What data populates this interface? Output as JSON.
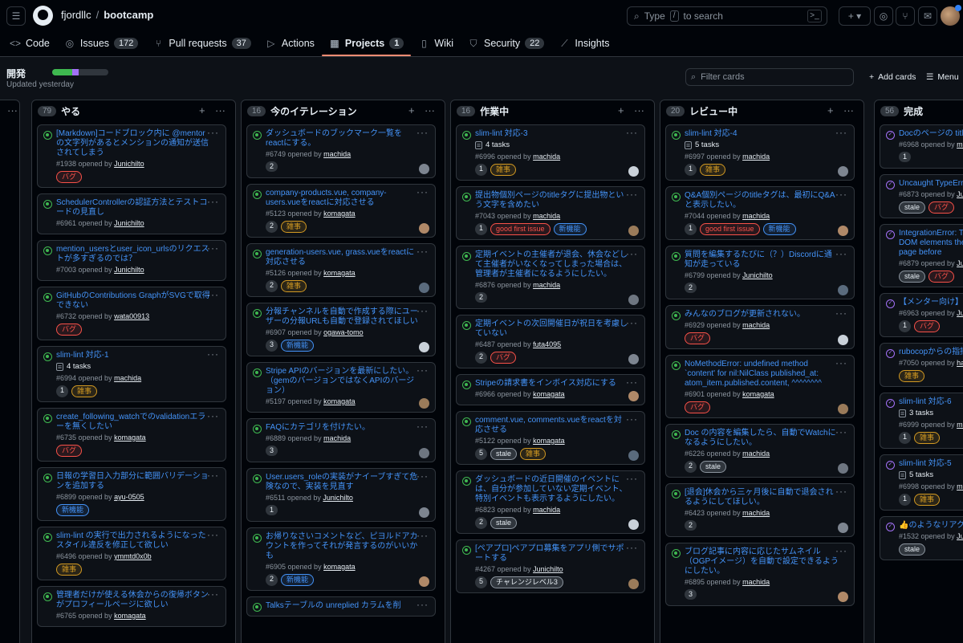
{
  "header": {
    "owner": "fjordllc",
    "separator": "/",
    "repo": "bootcamp",
    "search_label": "Type",
    "search_key": "/",
    "search_suffix": "to search"
  },
  "nav": [
    {
      "label": "Code",
      "icon": "<>",
      "count": ""
    },
    {
      "label": "Issues",
      "icon": "◎",
      "count": "172"
    },
    {
      "label": "Pull requests",
      "icon": "⑂",
      "count": "37"
    },
    {
      "label": "Actions",
      "icon": "▷",
      "count": ""
    },
    {
      "label": "Projects",
      "icon": "▦",
      "count": "1"
    },
    {
      "label": "Wiki",
      "icon": "▯",
      "count": ""
    },
    {
      "label": "Security",
      "icon": "⛉",
      "count": "22"
    },
    {
      "label": "Insights",
      "icon": "⟋",
      "count": ""
    }
  ],
  "project": {
    "title": "開発",
    "updated": "Updated yesterday",
    "progress": {
      "done": 0.35,
      "in_progress": 0.12
    },
    "filter_placeholder": "Filter cards",
    "add_cards": "Add cards",
    "menu": "Menu"
  },
  "colors": {
    "accent": "#4493f8",
    "open": "#3fb950",
    "done": "#a371f7",
    "bug": "#f85149",
    "chore": "#d29922",
    "feature": "#4493f8"
  },
  "columns": [
    {
      "count": "79",
      "title": "やる",
      "cards": [
        {
          "title": "[Markdown]コードブロック内に @mentor の文字列があるとメンションの通知が送信されてしまう",
          "meta_prefix": "#1938 opened by",
          "author": "Junichilto",
          "labels": [
            "バグ"
          ]
        },
        {
          "title": "SchedulerControllerの認証方法とテストコードの見直し",
          "meta_prefix": "#6961 opened by",
          "author": "Junichilto"
        },
        {
          "title": "mention_usersとuser_icon_urlsのリクエストが多すぎるのでは？",
          "meta_prefix": "#7003 opened by",
          "author": "Junichilto"
        },
        {
          "title": "GitHubのContributions GraphがSVGで取得できない",
          "meta_prefix": "#6732 opened by",
          "author": "wata00913",
          "labels": [
            "バグ"
          ]
        },
        {
          "title": "slim-lint 対応-1",
          "tasks": "4 tasks",
          "meta_prefix": "#6994 opened by",
          "author": "machida",
          "num": "1",
          "labels": [
            "雑事"
          ]
        },
        {
          "title": "create_following_watchでのvalidationエラーを無くしたい",
          "meta_prefix": "#6735 opened by",
          "author": "komagata",
          "labels": [
            "バグ"
          ]
        },
        {
          "title": "日報の学習日入力部分に範囲バリデーションを追加する",
          "meta_prefix": "#6899 opened by",
          "author": "ayu-0505",
          "labels": [
            "新機能"
          ]
        },
        {
          "title": "slim-lint の実行で出力されるようになったスタイル違反を修正して欲しい",
          "meta_prefix": "#6496 opened by",
          "author": "ymmtd0x0b",
          "labels": [
            "雑事"
          ]
        },
        {
          "title": "管理者だけが使える休会からの復帰ボタンがプロフィールページに欲しい",
          "meta_prefix": "#6765 opened by",
          "author": "komagata"
        }
      ]
    },
    {
      "count": "16",
      "title": "今のイテレーション",
      "cards": [
        {
          "title": "ダッシュボードのブックマーク一覧をreactにする。",
          "meta_prefix": "#6749 opened by",
          "author": "machida",
          "num": "2",
          "avatar": true
        },
        {
          "title": "company-products.vue, company-users.vueをreactに対応させる",
          "meta_prefix": "#5123 opened by",
          "author": "komagata",
          "num": "2",
          "labels": [
            "雑事"
          ],
          "avatar": true
        },
        {
          "title": "generation-users.vue, grass.vueをreactに対応させる",
          "meta_prefix": "#5126 opened by",
          "author": "komagata",
          "num": "2",
          "labels": [
            "雑事"
          ],
          "avatar": true
        },
        {
          "title": "分報チャンネルを自動で作成する際にユーザーの分報URLも自動で登録されてほしい",
          "meta_prefix": "#6907 opened by",
          "author": "ogawa-tomo",
          "num": "3",
          "labels": [
            "新機能"
          ],
          "avatar": true
        },
        {
          "title": "Stripe APIのバージョンを最新にしたい。（gemのバージョンではなくAPIのバージョン）",
          "meta_prefix": "#5197 opened by",
          "author": "komagata",
          "avatar": true
        },
        {
          "title": "FAQにカテゴリを付けたい。",
          "meta_prefix": "#6889 opened by",
          "author": "machida",
          "num": "3",
          "avatar": true
        },
        {
          "title": "User.users_roleの実装がナイーブすぎて危険なので、実装を見直す",
          "meta_prefix": "#6511 opened by",
          "author": "Junichilto",
          "num": "1",
          "avatar": true
        },
        {
          "title": "お帰りなさいコメントなど、ピヨルドアカウントを作ってそれが発言するのがいいかも",
          "meta_prefix": "#6905 opened by",
          "author": "komagata",
          "num": "2",
          "labels": [
            "新機能"
          ],
          "avatar": true
        },
        {
          "title": "Talksテーブルの unreplied カラムを削",
          "meta_prefix": "",
          "author": ""
        }
      ]
    },
    {
      "count": "16",
      "title": "作業中",
      "cards": [
        {
          "title": "slim-lint 対応-3",
          "tasks": "4 tasks",
          "meta_prefix": "#6996 opened by",
          "author": "machida",
          "num": "1",
          "labels": [
            "雑事"
          ],
          "avatar": true
        },
        {
          "title": "提出物個別ページのtitleタグに提出物という文字を含めたい",
          "meta_prefix": "#7043 opened by",
          "author": "machida",
          "num": "1",
          "labels": [
            "good first issue",
            "新機能"
          ],
          "avatar": true
        },
        {
          "title": "定期イベントの主催者が退会、休会などして主催者がいなくなってしまった場合は、管理者が主催者になるようにしたい。",
          "meta_prefix": "#6876 opened by",
          "author": "machida",
          "num": "2",
          "avatar": true
        },
        {
          "title": "定期イベントの次回開催日が祝日を考慮していない",
          "meta_prefix": "#6487 opened by",
          "author": "futa4095",
          "num": "2",
          "labels": [
            "バグ"
          ],
          "avatar": true
        },
        {
          "title": "Stripeの請求書をインボイス対応にする",
          "meta_prefix": "#6966 opened by",
          "author": "komagata",
          "avatar": true
        },
        {
          "title": "comment.vue, comments.vueをreactを対応させる",
          "meta_prefix": "#5122 opened by",
          "author": "komagata",
          "num": "5",
          "labels": [
            "stale",
            "雑事"
          ],
          "avatar": true
        },
        {
          "title": "ダッシュボードの近日開催のイベントには、自分が参加していない定期イベント、特別イベントも表示するようにしたい。",
          "meta_prefix": "#6823 opened by",
          "author": "machida",
          "num": "2",
          "labels": [
            "stale"
          ],
          "avatar": true
        },
        {
          "title": "[ペアプロ]ペアプロ募集をアプリ側でサポートする",
          "meta_prefix": "#4267 opened by",
          "author": "Junichilto",
          "num": "5",
          "labels": [
            "チャレンジレベル3"
          ],
          "avatar": true
        }
      ]
    },
    {
      "count": "20",
      "title": "レビュー中",
      "cards": [
        {
          "title": "slim-lint 対応-4",
          "tasks": "5 tasks",
          "meta_prefix": "#6997 opened by",
          "author": "machida",
          "num": "1",
          "labels": [
            "雑事"
          ],
          "avatar": true
        },
        {
          "title": "Q&A個別ページのtitleタグは、最初にQ&Aと表示したい。",
          "meta_prefix": "#7044 opened by",
          "author": "machida",
          "num": "1",
          "labels": [
            "good first issue",
            "新機能"
          ],
          "avatar": true
        },
        {
          "title": "質問を編集するたびに（？）Discordに通知が走っている",
          "meta_prefix": "#6799 opened by",
          "author": "Junichilto",
          "num": "2",
          "avatar": true
        },
        {
          "title": "みんなのブログが更新されない。",
          "meta_prefix": "#6929 opened by",
          "author": "machida",
          "labels": [
            "バグ"
          ],
          "avatar": true
        },
        {
          "title": "NoMethodError: undefined method `content' for nil:NilClass published_at: atom_item.published.content, ^^^^^^^^",
          "meta_prefix": "#6901 opened by",
          "author": "komagata",
          "labels": [
            "バグ"
          ],
          "avatar": true
        },
        {
          "title": "Doc の内容を編集したら、自動でWatchになるようにしたい。",
          "meta_prefix": "#6226 opened by",
          "author": "machida",
          "num": "2",
          "labels": [
            "stale"
          ],
          "avatar": true
        },
        {
          "title": "[退会]休会から三ヶ月後に自動で退会されるようにしてほしい。",
          "meta_prefix": "#6423 opened by",
          "author": "machida",
          "num": "2",
          "avatar": true
        },
        {
          "title": "ブログ記事に内容に応じたサムネイル（OGPイメージ）を自動で設定できるようにしたい。",
          "meta_prefix": "#6895 opened by",
          "author": "machida",
          "num": "3",
          "avatar": true
        }
      ]
    },
    {
      "count": "56",
      "title": "完成",
      "cards": [
        {
          "title": "Docのページの title と表示したい。",
          "meta_prefix": "#6968 opened by",
          "author": "mac",
          "num": "1",
          "done": true
        },
        {
          "title": "Uncaught TypeError properties of null (",
          "meta_prefix": "#6873 opened by",
          "author": "Jun",
          "labels": [
            "stale",
            "バグ"
          ],
          "done": true
        },
        {
          "title": "IntegrationError: T specified (#card-e no DOM elements the page. Make su on the page before",
          "meta_prefix": "#6879 opened by",
          "author": "Jun",
          "labels": [
            "stale",
            "バグ"
          ],
          "done": true
        },
        {
          "title": "【メンター向け】「す！」の通知メール",
          "meta_prefix": "#6963 opened by",
          "author": "Ju",
          "num": "1",
          "labels": [
            "バグ"
          ],
          "done": true
        },
        {
          "title": "rubocopからの指摘",
          "meta_prefix": "#7050 opened by",
          "author": "har",
          "labels": [
            "雑事"
          ],
          "done": true
        },
        {
          "title": "slim-lint 対応-6",
          "tasks": "3 tasks",
          "meta_prefix": "#6999 opened by",
          "author": "ma",
          "num": "1",
          "labels": [
            "雑事"
          ],
          "done": true
        },
        {
          "title": "slim-lint 対応-5",
          "tasks": "5 tasks",
          "meta_prefix": "#6998 opened by",
          "author": "ma",
          "num": "1",
          "labels": [
            "雑事"
          ],
          "done": true
        },
        {
          "title": "👍のようなリアクションする",
          "meta_prefix": "#1532 opened by",
          "author": "Jun",
          "labels": [
            "stale"
          ],
          "done": true
        }
      ]
    }
  ]
}
